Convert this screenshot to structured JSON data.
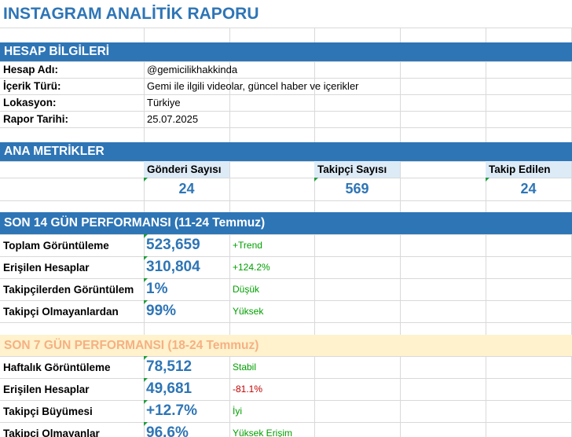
{
  "title": "INSTAGRAM ANALİTİK RAPORU",
  "account_section": {
    "header": "HESAP BİLGİLERİ",
    "rows": [
      {
        "label": "Hesap Adı:",
        "value": "@gemicilikhakkinda"
      },
      {
        "label": "İçerik Türü:",
        "value": "Gemi ile ilgili videolar, güncel haber ve içerikler"
      },
      {
        "label": "Lokasyon:",
        "value": "Türkiye"
      },
      {
        "label": "Rapor Tarihi:",
        "value": "25.07.2025"
      }
    ]
  },
  "main_metrics": {
    "header": "ANA METRİKLER",
    "items": [
      {
        "label": "Gönderi Sayısı",
        "value": "24"
      },
      {
        "label": "Takipçi Sayısı",
        "value": "569"
      },
      {
        "label": "Takip Edilen",
        "value": "24"
      }
    ]
  },
  "perf14": {
    "header": "SON 14 GÜN PERFORMANSI (11-24 Temmuz)",
    "rows": [
      {
        "label": "Toplam Görüntüleme",
        "value": "523,659",
        "note": "+Trend",
        "note_color": "#00a000"
      },
      {
        "label": "Erişilen Hesaplar",
        "value": "310,804",
        "note": "+124.2%",
        "note_color": "#00a000"
      },
      {
        "label": "Takipçilerden Görüntülem",
        "value": "1%",
        "note": "Düşük",
        "note_color": "#00a000"
      },
      {
        "label": "Takipçi Olmayanlardan",
        "value": "99%",
        "note": "Yüksek",
        "note_color": "#00a000"
      }
    ]
  },
  "perf7": {
    "header": "SON 7 GÜN PERFORMANSI (18-24 Temmuz)",
    "rows": [
      {
        "label": "Haftalık Görüntüleme",
        "value": "78,512",
        "note": "Stabil",
        "note_color": "#00a000"
      },
      {
        "label": "Erişilen Hesaplar",
        "value": "49,681",
        "note": "-81.1%",
        "note_color": "#c00000"
      },
      {
        "label": "Takipçi Büyümesi",
        "value": "+12.7%",
        "note": "İyi",
        "note_color": "#00a000"
      },
      {
        "label": "Takipçi Olmayanlar",
        "value": "96.6%",
        "note": "Yüksek Erişim",
        "note_color": "#00a000"
      }
    ]
  }
}
